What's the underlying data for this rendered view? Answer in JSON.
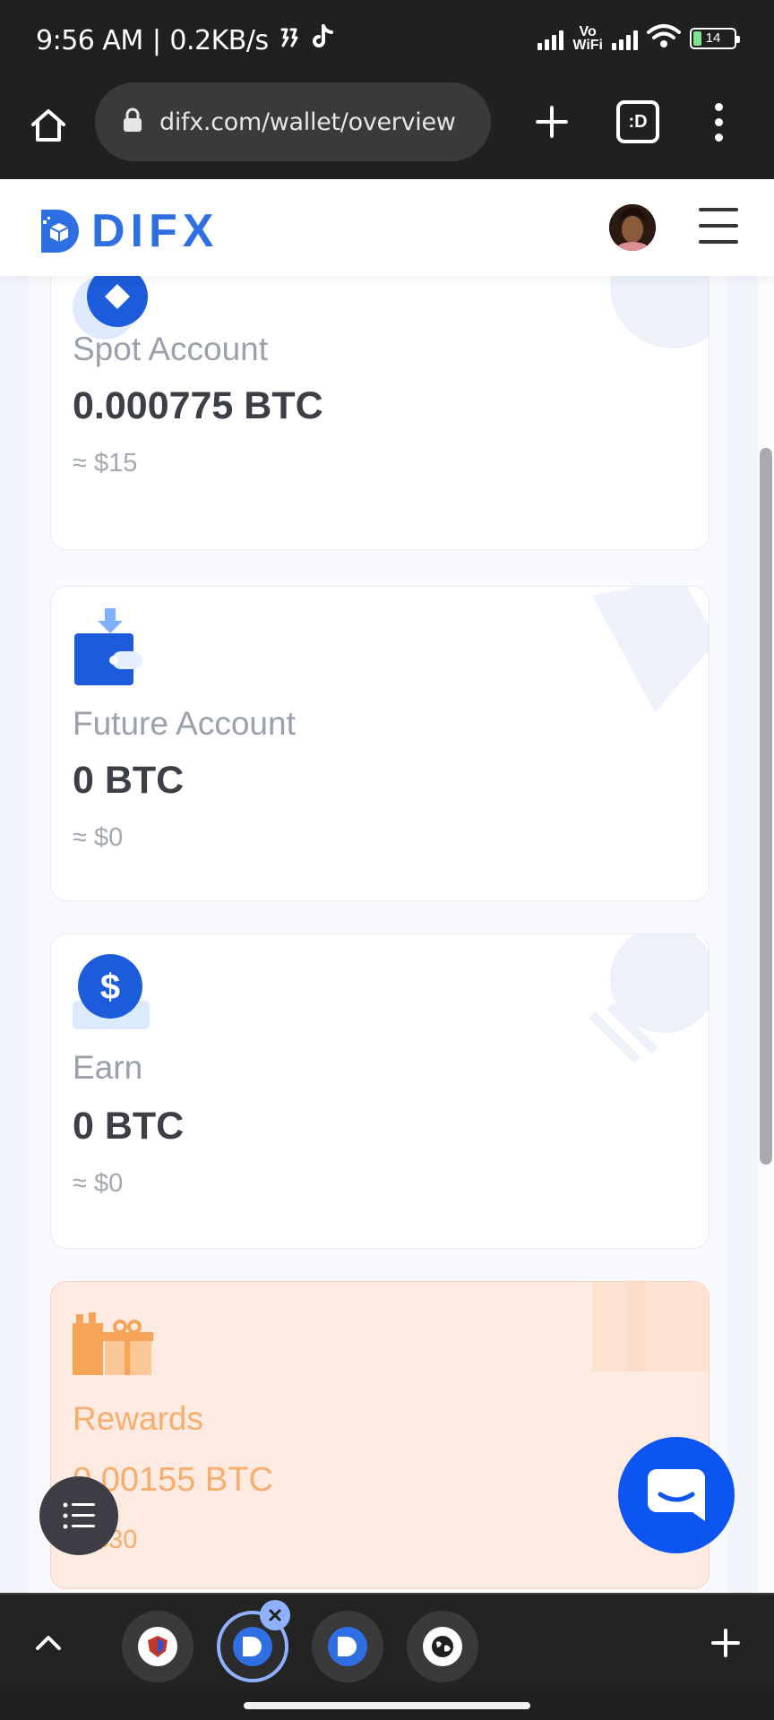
{
  "status_bar": {
    "time": "9:56 AM",
    "net_speed": "0.2KB/s",
    "vowifi_top": "Vo",
    "vowifi_bottom": "WiFi",
    "battery": "14"
  },
  "browser": {
    "url": "difx.com/wallet/overview",
    "tabs_label": ":D"
  },
  "site": {
    "logo_text": "DIFX"
  },
  "cards": [
    {
      "title": "Spot Account",
      "value": "0.000775 BTC",
      "fiat": "≈ $15"
    },
    {
      "title": "Future Account",
      "value": "0 BTC",
      "fiat": "≈ $0"
    },
    {
      "title": "Earn",
      "value": "0 BTC",
      "fiat": "≈ $0"
    },
    {
      "title": "Rewards",
      "value": "0.00155 BTC",
      "fiat": "≈ $30"
    }
  ],
  "colors": {
    "brand_blue": "#2f6fe4",
    "chat_blue": "#0d55f0",
    "rewards_orange": "#f7ad6e",
    "rewards_bg": "#fdebe2"
  },
  "icons": {
    "spot": "diamond-badge-icon",
    "future": "wallet-download-icon",
    "earn": "dollar-coin-icon",
    "rewards": "gift-icon"
  }
}
